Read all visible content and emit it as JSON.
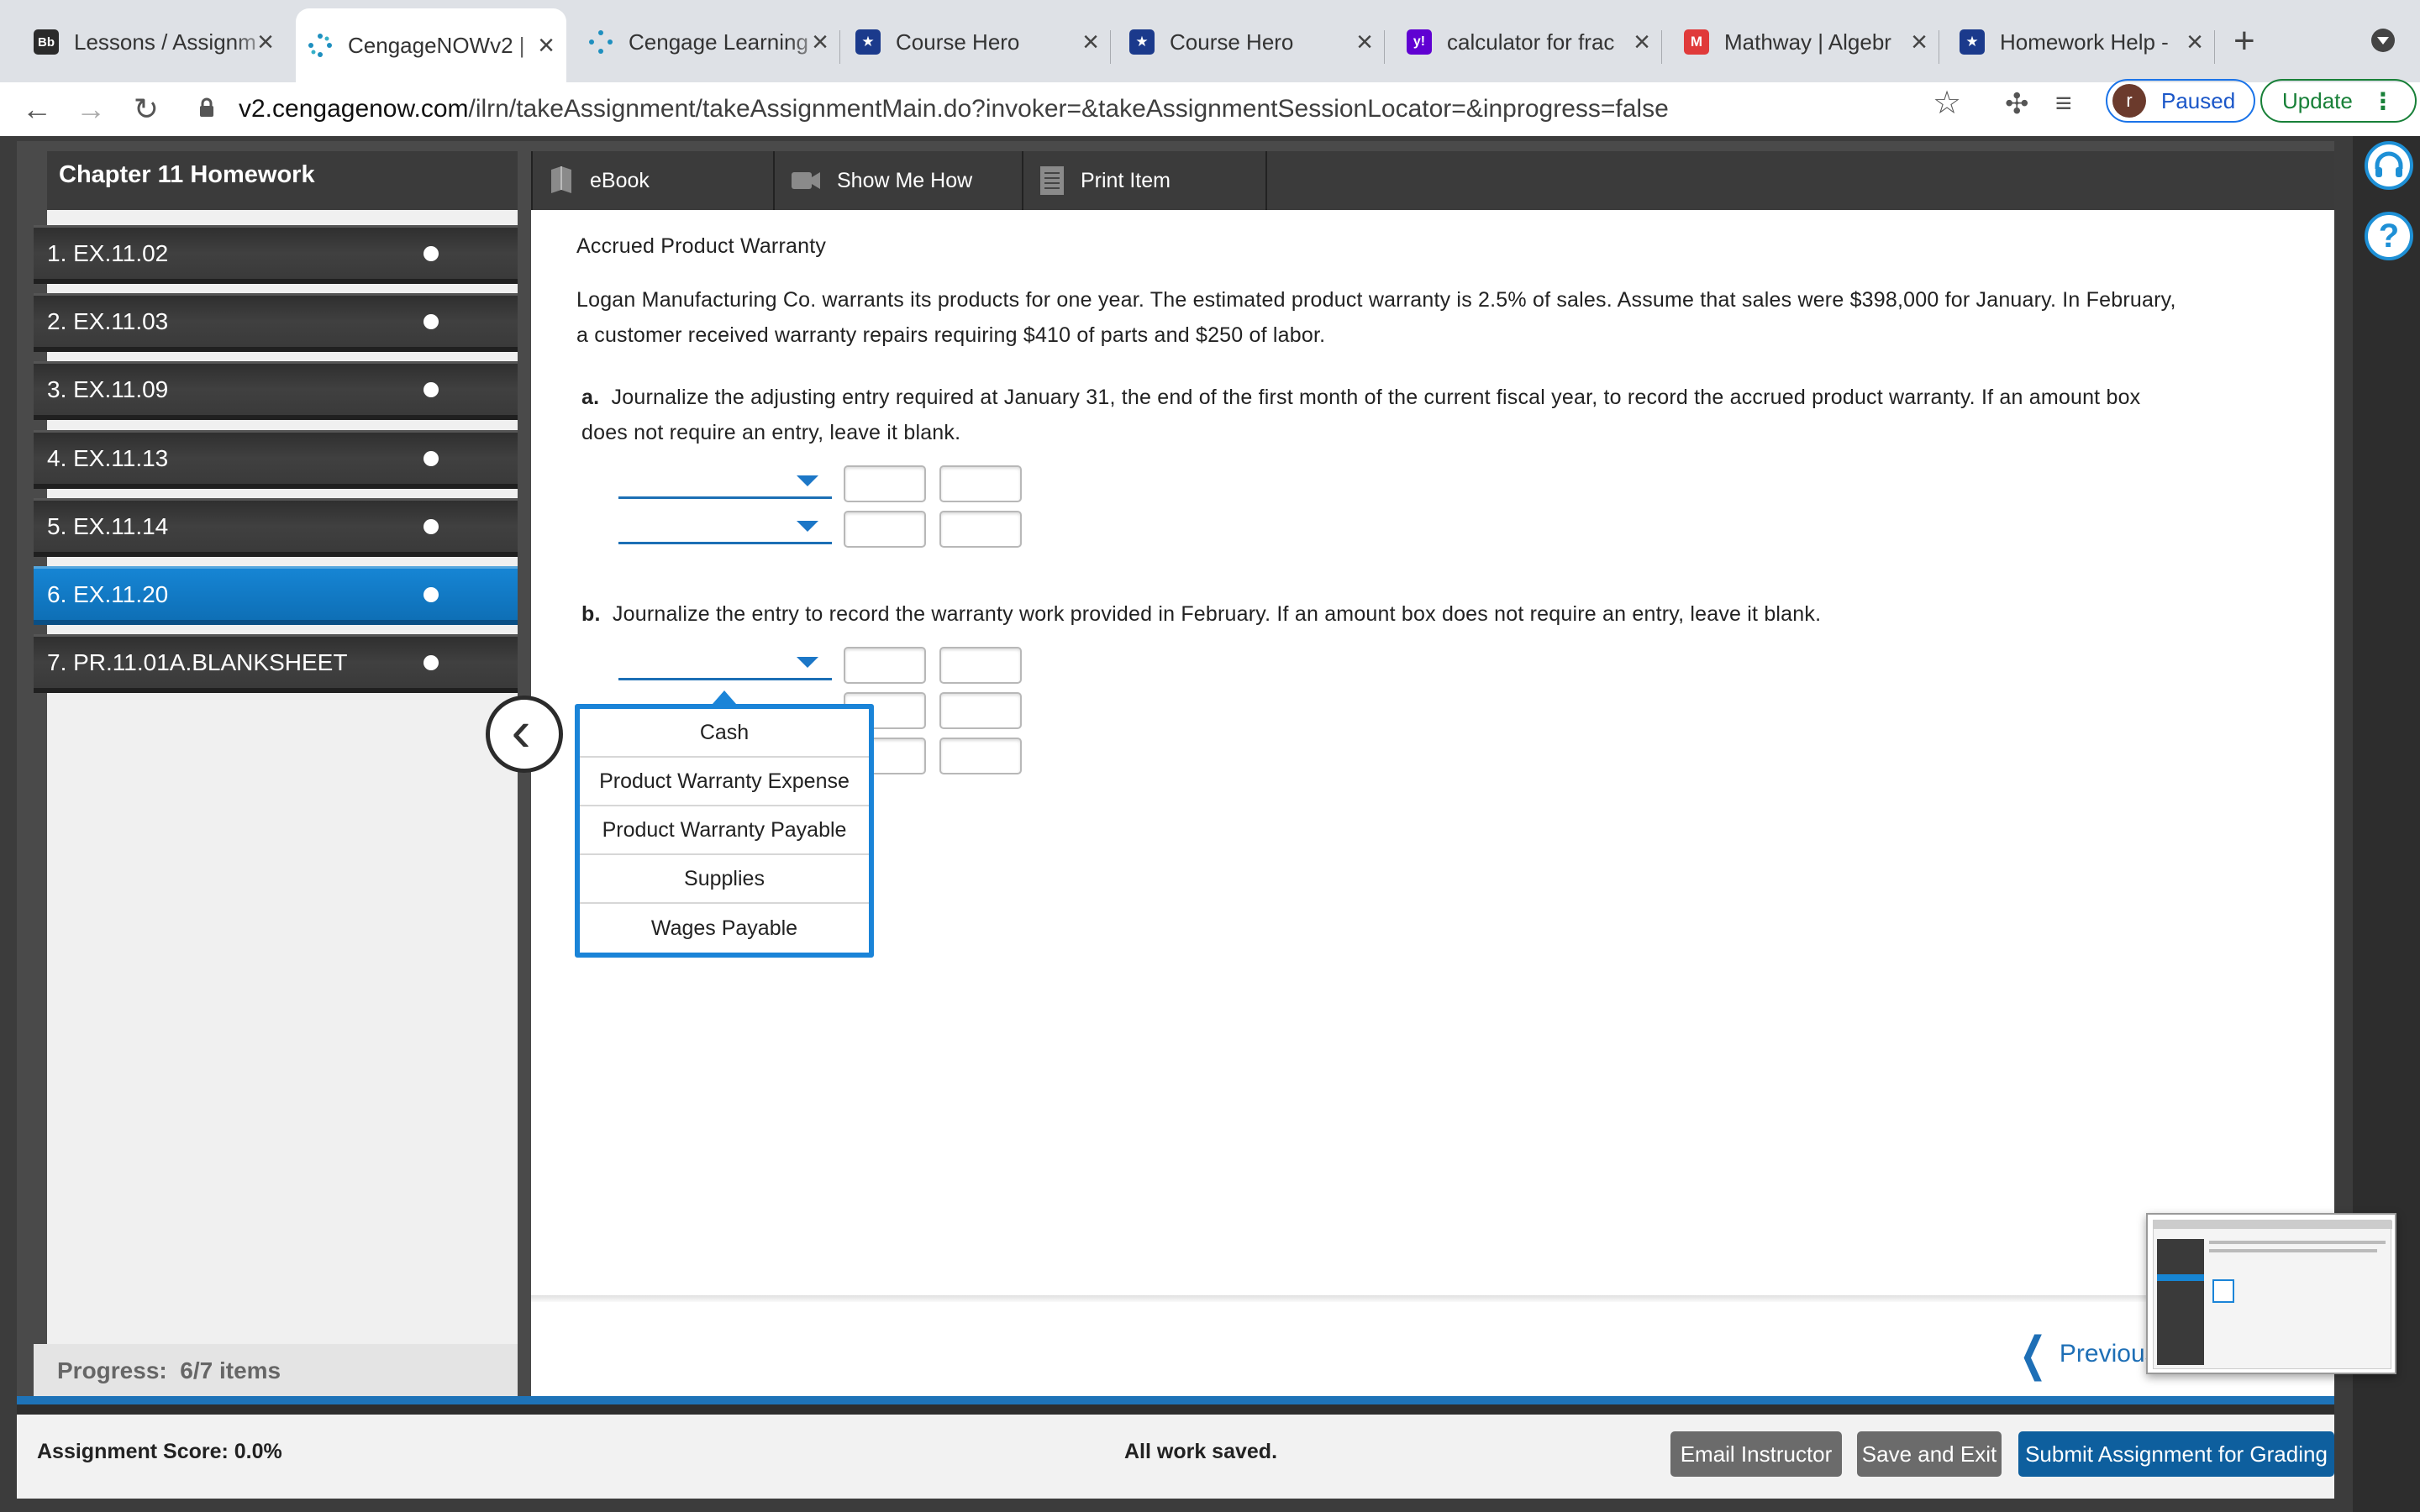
{
  "browser": {
    "tabs": [
      {
        "title": "Lessons / Assignm",
        "favicon": "Bb"
      },
      {
        "title": "CengageNOWv2 |",
        "favicon": "cengage"
      },
      {
        "title": "Cengage Learning",
        "favicon": "cengage"
      },
      {
        "title": "Course Hero",
        "favicon": "coursehero"
      },
      {
        "title": "Course Hero",
        "favicon": "coursehero"
      },
      {
        "title": "calculator for frac",
        "favicon": "y!"
      },
      {
        "title": "Mathway | Algebr",
        "favicon": "M"
      },
      {
        "title": "Homework Help -",
        "favicon": "coursehero"
      }
    ],
    "url_host": "v2.cengagenow.com",
    "url_path": "/ilrn/takeAssignment/takeAssignmentMain.do?invoker=&takeAssignmentSessionLocator=&inprogress=false",
    "profile_initial": "r",
    "profile_status": "Paused",
    "update_label": "Update"
  },
  "app": {
    "title": "Chapter 11 Homework",
    "toolbar": {
      "ebook": "eBook",
      "show_me_how": "Show Me How",
      "print_item": "Print Item"
    },
    "items": [
      "1. EX.11.02",
      "2. EX.11.03",
      "3. EX.11.09",
      "4. EX.11.13",
      "5. EX.11.14",
      "6. EX.11.20",
      "7. PR.11.01A.BLANKSHEET"
    ],
    "selected_item_index": 5,
    "progress_label": "Progress:",
    "progress_value": "6/7 items"
  },
  "question": {
    "heading": "Accrued Product Warranty",
    "body_line1": "Logan Manufacturing Co. warrants its products for one year. The estimated product warranty is 2.5% of sales. Assume that sales were $398,000 for January. In February,",
    "body_line2": "a customer received warranty repairs requiring $410 of parts and $250 of labor.",
    "part_a_letter": "a.",
    "part_a_line1": "Journalize the adjusting entry required at January 31, the end of the first month of the current fiscal year, to record the accrued product warranty. If an amount box",
    "part_a_line2": "does not require an entry, leave it blank.",
    "part_b_letter": "b.",
    "part_b_text": "Journalize the entry to record the warranty work provided in February. If an amount box does not require an entry, leave it blank.",
    "dropdown_options": [
      "Cash",
      "Product Warranty Expense",
      "Product Warranty Payable",
      "Supplies",
      "Wages Payable"
    ]
  },
  "nav": {
    "previous": "Previous"
  },
  "footer": {
    "score": "Assignment Score: 0.0%",
    "status": "All work saved.",
    "email": "Email Instructor",
    "save_exit": "Save and Exit",
    "submit": "Submit Assignment for Grading"
  },
  "colors": {
    "accent_blue": "#1a84d8",
    "selected_item": "#1685d4",
    "submit_button": "#0e5f9e",
    "gray_button": "#6b6b6b"
  }
}
